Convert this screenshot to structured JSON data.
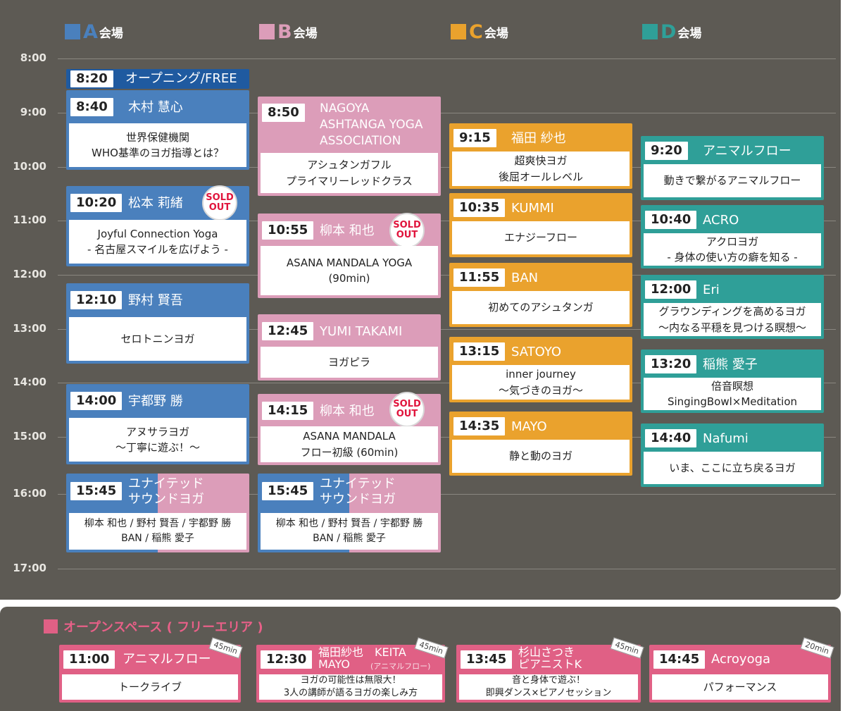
{
  "venues": [
    {
      "letter": "A",
      "label": "会場",
      "color": "#4a80bd"
    },
    {
      "letter": "B",
      "label": "会場",
      "color": "#dc9db9"
    },
    {
      "letter": "C",
      "label": "会場",
      "color": "#eaa22d"
    },
    {
      "letter": "D",
      "label": "会場",
      "color": "#2f9f98"
    }
  ],
  "times": [
    "8:00",
    "9:00",
    "10:00",
    "11:00",
    "12:00",
    "13:00",
    "14:00",
    "15:00",
    "16:00",
    "17:00"
  ],
  "sold_out": "SOLD OUT",
  "a": [
    {
      "time": "8:20",
      "name": "オープニング/FREE"
    },
    {
      "time": "8:40",
      "name": "木村 慧心",
      "line1": "世界保健機関",
      "line2": "WHO基準のヨガ指導とは？"
    },
    {
      "time": "10:20",
      "name": "松本 莉緒",
      "line1": "Joyful Connection Yoga",
      "line2": "- 名古屋スマイルを広げよう -"
    },
    {
      "time": "12:10",
      "name": "野村 賢吾",
      "line1": "セロトニンヨガ"
    },
    {
      "time": "14:00",
      "name": "宇都野 勝",
      "line1": "アヌサラヨガ",
      "line2": "〜丁寧に遊ぶ！〜"
    },
    {
      "time": "15:45",
      "name1": "ユナイテッド",
      "name2": "サウンドヨガ",
      "line1": "柳本 和也 / 野村 賢吾 / 宇都野 勝",
      "line2": "BAN / 稲熊 愛子"
    }
  ],
  "b": [
    {
      "time": "8:50",
      "name1": "NAGOYA",
      "name2": "ASHTANGA YOGA",
      "name3": "ASSOCIATION",
      "line1": "アシュタンガフル",
      "line2": "プライマリーレッドクラス"
    },
    {
      "time": "10:55",
      "name": "柳本 和也",
      "line1": "ASANA MANDALA YOGA",
      "line2": "(90min)"
    },
    {
      "time": "12:45",
      "name": "YUMI TAKAMI",
      "line1": "ヨガピラ"
    },
    {
      "time": "14:15",
      "name": "柳本 和也",
      "line1": "ASANA MANDALA",
      "line2": "フロー初級 (60min)"
    },
    {
      "time": "15:45",
      "name1": "ユナイテッド",
      "name2": "サウンドヨガ",
      "line1": "柳本 和也 / 野村 賢吾 / 宇都野 勝",
      "line2": "BAN / 稲熊 愛子"
    }
  ],
  "c": [
    {
      "time": "9:15",
      "name": "福田 紗也",
      "line1": "超爽快ヨガ",
      "line2": "後屈オールレベル"
    },
    {
      "time": "10:35",
      "name": "KUMMI",
      "line1": "エナジーフロー"
    },
    {
      "time": "11:55",
      "name": "BAN",
      "line1": "初めてのアシュタンガ"
    },
    {
      "time": "13:15",
      "name": "SATOYO",
      "line1": "inner journey",
      "line2": "〜気づきのヨガ〜"
    },
    {
      "time": "14:35",
      "name": "MAYO",
      "line1": "静と動のヨガ"
    }
  ],
  "d": [
    {
      "time": "9:20",
      "name": "アニマルフロー",
      "line1": "動きで繋がるアニマルフロー"
    },
    {
      "time": "10:40",
      "name": "ACRO",
      "line1": "アクロヨガ",
      "line2": "- 身体の使い方の癖を知る -"
    },
    {
      "time": "12:00",
      "name": "Eri",
      "line1": "グラウンディングを高めるヨガ",
      "line2": "〜内なる平穏を見つける瞑想〜"
    },
    {
      "time": "13:20",
      "name": "稲熊 愛子",
      "line1": "倍音瞑想",
      "line2": "SingingBowl×Meditation"
    },
    {
      "time": "14:40",
      "name": "Nafumi",
      "line1": "いま、ここに立ち戻るヨガ"
    }
  ],
  "open_space": {
    "title": "オープンスペース ( フリーエリア )",
    "items": [
      {
        "time": "11:00",
        "name": "アニマルフロー",
        "badge": "45min",
        "line1": "トークライブ"
      },
      {
        "time": "12:30",
        "name1": "福田紗也　KEITA",
        "name2": "MAYO",
        "sub": "(アニマルフロー)",
        "badge": "45min",
        "line1": "ヨガの可能性は無限大！",
        "line2": "3人の講師が語るヨガの楽しみ方"
      },
      {
        "time": "13:45",
        "name1": "杉山さつき",
        "name2": "ピアニストK",
        "badge": "45min",
        "line1": "音と身体で遊ぶ！",
        "line2": "即興ダンス×ピアノセッション"
      },
      {
        "time": "14:45",
        "name": "Acroyoga",
        "badge": "20min",
        "line1": "パフォーマンス"
      }
    ]
  }
}
